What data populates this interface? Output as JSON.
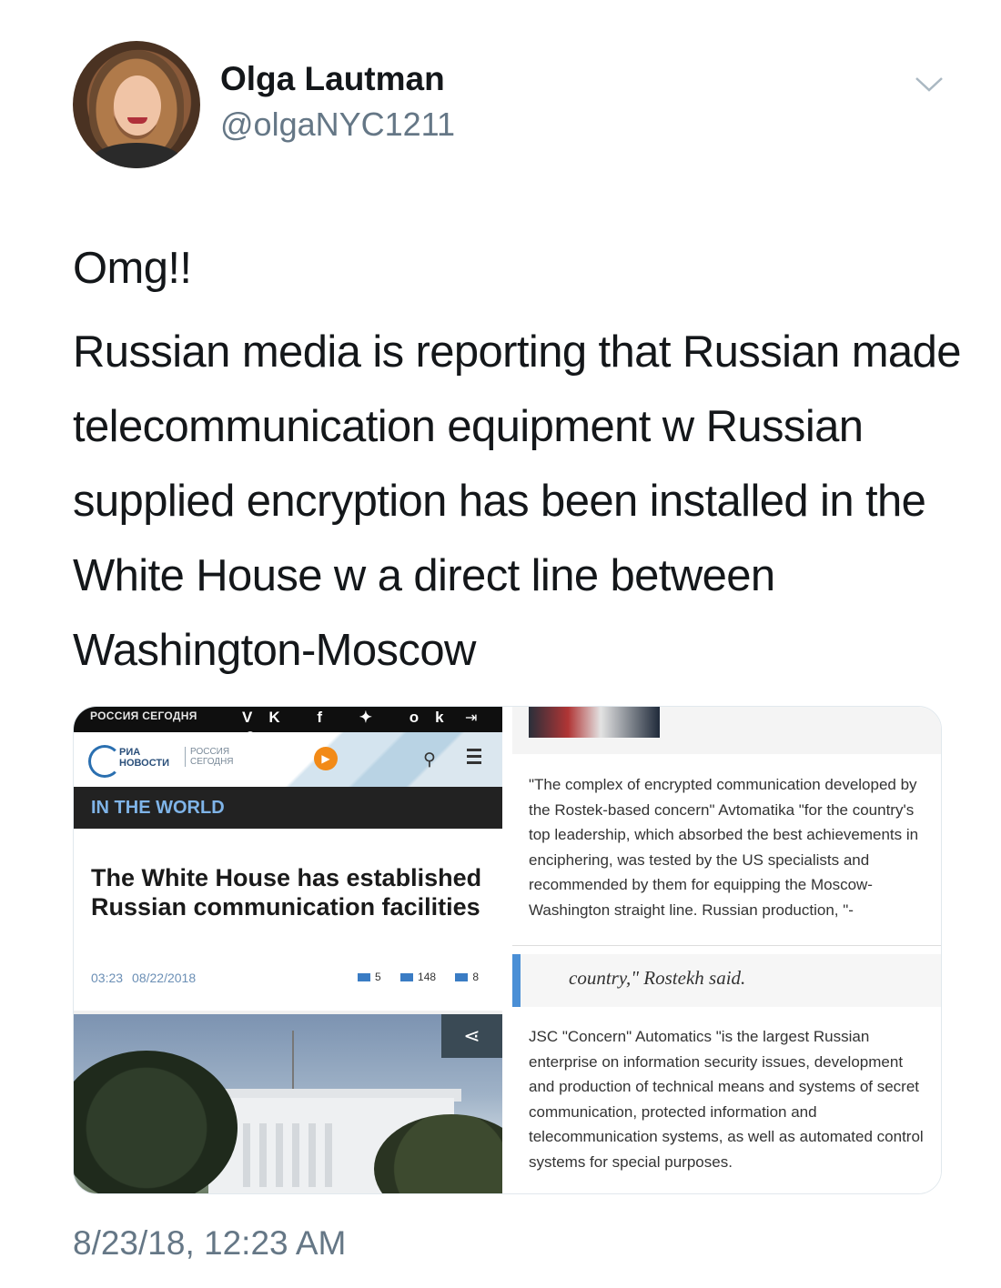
{
  "author": {
    "name": "Olga Lautman",
    "handle": "@olgaNYC1211"
  },
  "tweet": {
    "lead": "Omg!!",
    "body": "Russian media is reporting that Russian made telecommunication equipment w Russian supplied encryption has been installed in the White House w a direct line between Washington-Moscow",
    "timestamp": "8/23/18, 12:23 AM"
  },
  "left_screenshot": {
    "topbar_brand": "РОССИЯ СЕГОДНЯ",
    "social_icons": "VK f ✦ ok ☻",
    "logo_name_line1": "РИА",
    "logo_name_line2": "НОВОСТИ",
    "logo_sub_line1": "РОССИЯ",
    "logo_sub_line2": "СЕГОДНЯ",
    "section": "IN THE WORLD",
    "headline": "The White House has established Russian communication facilities",
    "time": "03:23",
    "date": "08/22/2018",
    "comments": "5",
    "likes": "148",
    "dislikes": "8"
  },
  "right_screenshot": {
    "quote": "\"The complex of encrypted communication developed by the Rostek-based concern\" Avtomatika \"for the country's top leadership, which absorbed the best achievements in enciphering, was tested by the US specialists and recommended by them for equipping the Moscow-Washington straight line. Russian production, \"-",
    "quote_end": "country,\" Rostekh said.",
    "body": "JSC \"Concern\" Automatics \"is the largest Russian enterprise on information security issues, development and production of technical means and systems of secret communication, protected information and telecommunication systems, as well as automated control systems for special purposes."
  },
  "colors": {
    "text": "#14171a",
    "secondary": "#657786",
    "section_text": "#7fb4e8",
    "accent_orange": "#f28a17",
    "quote_bar": "#4a8fd6"
  }
}
